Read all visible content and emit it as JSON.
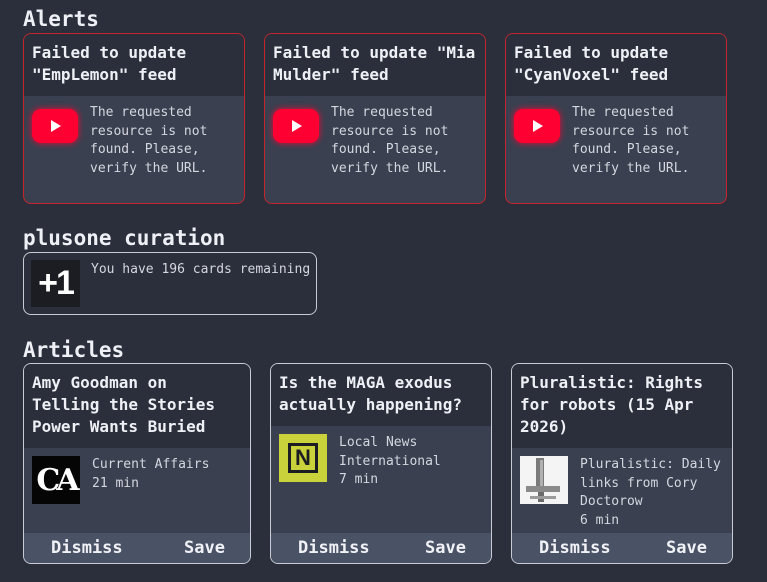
{
  "alerts": {
    "title": "Alerts",
    "items": [
      {
        "title": "Failed to update \"EmpLemon\" feed",
        "message": "The requested resource is not found. Please, verify the URL."
      },
      {
        "title": "Failed to update \"Mia Mulder\" feed",
        "message": "The requested resource is not found. Please, verify the URL."
      },
      {
        "title": "Failed to update \"CyanVoxel\" feed",
        "message": "The requested resource is not found. Please, verify the URL."
      }
    ]
  },
  "curation": {
    "title": "plusone curation",
    "badge": "+1",
    "message": "You have 196 cards remaining"
  },
  "articles": {
    "title": "Articles",
    "dismiss_label": "Dismiss",
    "save_label": "Save",
    "items": [
      {
        "title": "Amy Goodman on Telling the Stories Power Wants Buried",
        "source": "Current Affairs",
        "read_time": "21 min",
        "thumb_text": "CA"
      },
      {
        "title": "Is the MAGA exodus actually happening?",
        "source": "Local News International",
        "read_time": "7 min",
        "thumb_text": "N"
      },
      {
        "title": "Pluralistic: Rights for robots (15 Apr 2026)",
        "source": "Pluralistic: Daily links from Cory Doctorow",
        "read_time": "6 min"
      }
    ]
  },
  "colors": {
    "background": "#2a2f3b",
    "alert_border": "#c1262c",
    "youtube_red": "#ff0033",
    "footer": "#4a5266"
  },
  "icons": [
    "youtube-icon",
    "plusone-logo",
    "current-affairs-logo",
    "local-news-logo",
    "pluralistic-logo"
  ]
}
